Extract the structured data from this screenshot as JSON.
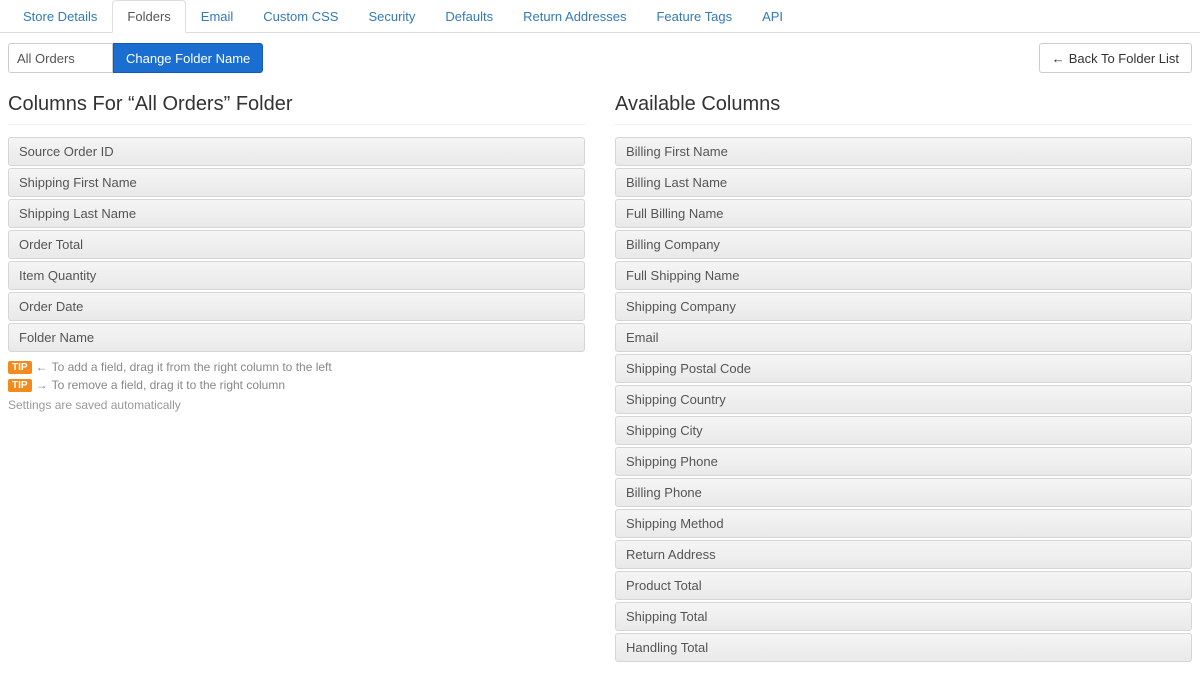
{
  "tabs": [
    {
      "label": "Store Details",
      "active": false
    },
    {
      "label": "Folders",
      "active": true
    },
    {
      "label": "Email",
      "active": false
    },
    {
      "label": "Custom CSS",
      "active": false
    },
    {
      "label": "Security",
      "active": false
    },
    {
      "label": "Defaults",
      "active": false
    },
    {
      "label": "Return Addresses",
      "active": false
    },
    {
      "label": "Feature Tags",
      "active": false
    },
    {
      "label": "API",
      "active": false
    }
  ],
  "toolbar": {
    "folder_name_value": "All Orders",
    "change_button_label": "Change Folder Name",
    "back_button_label": "Back To Folder List"
  },
  "left": {
    "heading": "Columns For “All Orders” Folder",
    "items": [
      "Source Order ID",
      "Shipping First Name",
      "Shipping Last Name",
      "Order Total",
      "Item Quantity",
      "Order Date",
      "Folder Name"
    ]
  },
  "right": {
    "heading": "Available Columns",
    "items": [
      "Billing First Name",
      "Billing Last Name",
      "Full Billing Name",
      "Billing Company",
      "Full Shipping Name",
      "Shipping Company",
      "Email",
      "Shipping Postal Code",
      "Shipping Country",
      "Shipping City",
      "Shipping Phone",
      "Billing Phone",
      "Shipping Method",
      "Return Address",
      "Product Total",
      "Shipping Total",
      "Handling Total"
    ]
  },
  "tips": {
    "badge": "TIP",
    "add": "To add a field, drag it from the right column to the left",
    "remove": "To remove a field, drag it to the right column",
    "autosave": "Settings are saved automatically"
  }
}
